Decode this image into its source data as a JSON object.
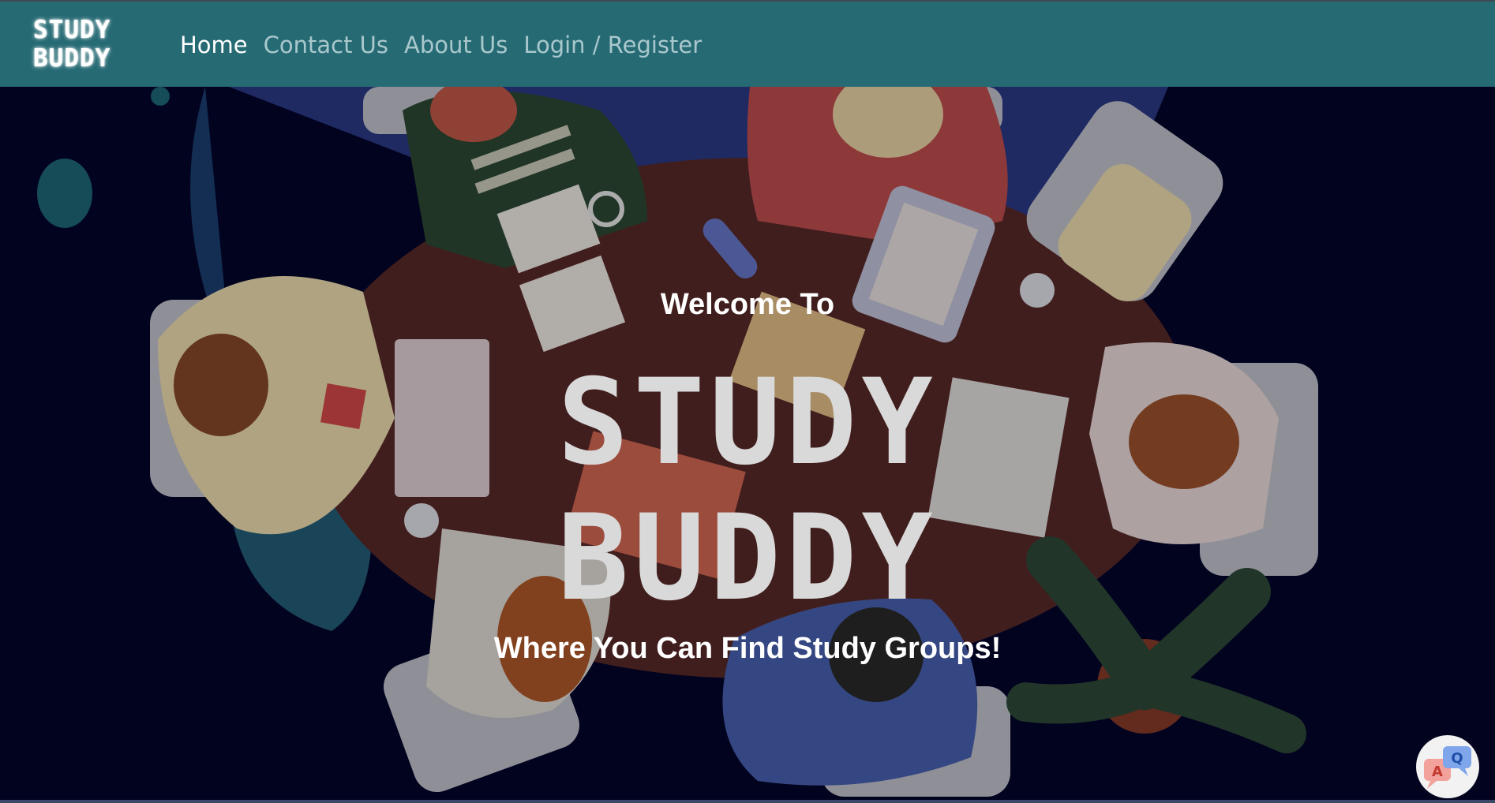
{
  "brand": {
    "line1": "STUDY",
    "line2": "BUDDY"
  },
  "nav": {
    "items": [
      {
        "label": "Home",
        "active": true
      },
      {
        "label": "Contact Us",
        "active": false
      },
      {
        "label": "About Us",
        "active": false
      },
      {
        "label": "Login / Register",
        "active": false
      }
    ]
  },
  "hero": {
    "welcome": "Welcome To",
    "title_line1": "STUDY",
    "title_line2": "BUDDY",
    "tagline": "Where You Can Find Study Groups!"
  },
  "translate_widget": {
    "icon": "translate-icon",
    "letter_a": "A",
    "letter_q": "Q"
  },
  "colors": {
    "navbar": "#266a74",
    "background": "#03052b",
    "nav_active": "#ffffff",
    "nav_inactive": "#a9c8cd"
  }
}
